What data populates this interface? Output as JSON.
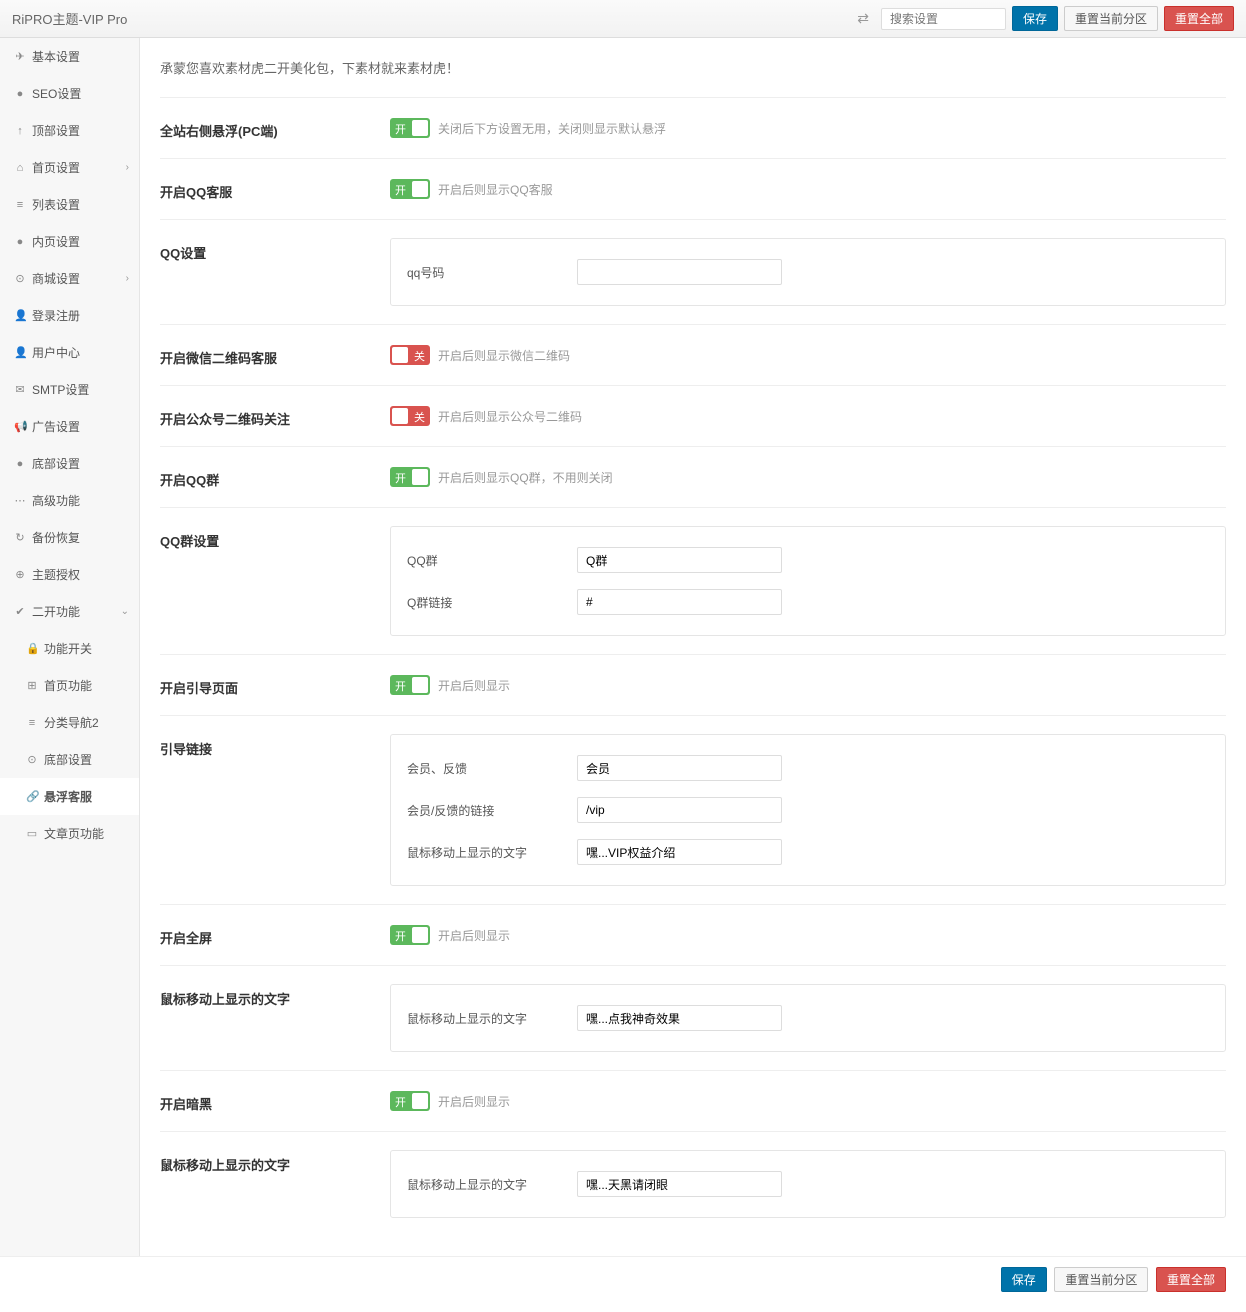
{
  "header": {
    "title": "RiPRO主题-VIP Pro",
    "search_placeholder": "搜索设置",
    "save": "保存",
    "reset_section": "重置当前分区",
    "reset_all": "重置全部"
  },
  "sidebar": {
    "items": [
      {
        "icon": "✈",
        "label": "基本设置"
      },
      {
        "icon": "●",
        "label": "SEO设置"
      },
      {
        "icon": "↑",
        "label": "顶部设置"
      },
      {
        "icon": "⌂",
        "label": "首页设置",
        "chevron": true
      },
      {
        "icon": "≡",
        "label": "列表设置"
      },
      {
        "icon": "●",
        "label": "内页设置"
      },
      {
        "icon": "⊙",
        "label": "商城设置",
        "chevron": true
      },
      {
        "icon": "👤",
        "label": "登录注册"
      },
      {
        "icon": "👤",
        "label": "用户中心"
      },
      {
        "icon": "✉",
        "label": "SMTP设置"
      },
      {
        "icon": "📢",
        "label": "广告设置"
      },
      {
        "icon": "●",
        "label": "底部设置"
      },
      {
        "icon": "⋯",
        "label": "高级功能"
      },
      {
        "icon": "↻",
        "label": "备份恢复"
      },
      {
        "icon": "⊕",
        "label": "主题授权"
      },
      {
        "icon": "✔",
        "label": "二开功能",
        "expanded": true
      }
    ],
    "subitems": [
      {
        "icon": "🔒",
        "label": "功能开关"
      },
      {
        "icon": "⊞",
        "label": "首页功能"
      },
      {
        "icon": "≡",
        "label": "分类导航2"
      },
      {
        "icon": "⊙",
        "label": "底部设置"
      },
      {
        "icon": "🔗",
        "label": "悬浮客服",
        "active": true
      },
      {
        "icon": "▭",
        "label": "文章页功能"
      }
    ]
  },
  "main": {
    "intro": "承蒙您喜欢素材虎二开美化包，下素材就来素材虎！",
    "fields": {
      "f1": {
        "label": "全站右侧悬浮(PC端)",
        "on": true,
        "on_text": "开",
        "desc": "关闭后下方设置无用，关闭则显示默认悬浮"
      },
      "f2": {
        "label": "开启QQ客服",
        "on": true,
        "on_text": "开",
        "desc": "开启后则显示QQ客服"
      },
      "f3": {
        "label": "QQ设置",
        "sub": {
          "l1": "qq号码",
          "v1": ""
        }
      },
      "f4": {
        "label": "开启微信二维码客服",
        "on": false,
        "off_text": "关",
        "desc": "开启后则显示微信二维码"
      },
      "f5": {
        "label": "开启公众号二维码关注",
        "on": false,
        "off_text": "关",
        "desc": "开启后则显示公众号二维码"
      },
      "f6": {
        "label": "开启QQ群",
        "on": true,
        "on_text": "开",
        "desc": "开启后则显示QQ群，不用则关闭"
      },
      "f7": {
        "label": "QQ群设置",
        "sub": {
          "l1": "QQ群",
          "v1": "Q群",
          "l2": "Q群链接",
          "v2": "#"
        }
      },
      "f8": {
        "label": "开启引导页面",
        "on": true,
        "on_text": "开",
        "desc": "开启后则显示"
      },
      "f9": {
        "label": "引导链接",
        "sub": {
          "l1": "会员、反馈",
          "v1": "会员",
          "l2": "会员/反馈的链接",
          "v2": "/vip",
          "l3": "鼠标移动上显示的文字",
          "v3": "嘿...VIP权益介绍"
        }
      },
      "f10": {
        "label": "开启全屏",
        "on": true,
        "on_text": "开",
        "desc": "开启后则显示"
      },
      "f11": {
        "label": "鼠标移动上显示的文字",
        "sub": {
          "l1": "鼠标移动上显示的文字",
          "v1": "嘿...点我神奇效果"
        }
      },
      "f12": {
        "label": "开启暗黑",
        "on": true,
        "on_text": "开",
        "desc": "开启后则显示"
      },
      "f13": {
        "label": "鼠标移动上显示的文字",
        "sub": {
          "l1": "鼠标移动上显示的文字",
          "v1": "嘿...天黑请闭眼"
        }
      }
    }
  },
  "footer": {
    "save": "保存",
    "reset_section": "重置当前分区",
    "reset_all": "重置全部"
  }
}
